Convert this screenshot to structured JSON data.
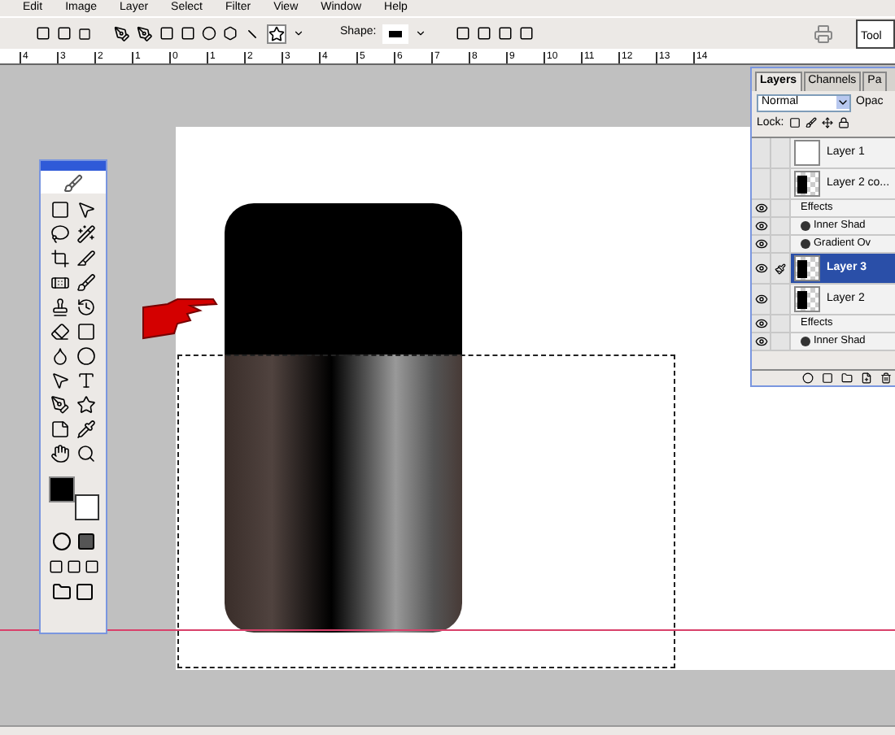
{
  "menu": [
    "Edit",
    "Image",
    "Layer",
    "Select",
    "Filter",
    "View",
    "Window",
    "Help"
  ],
  "options_bar": {
    "shape_label": "Shape:",
    "tool_tab": "Tool"
  },
  "ruler": [
    "4",
    "3",
    "2",
    "1",
    "0",
    "1",
    "2",
    "3",
    "4",
    "5",
    "6",
    "7",
    "8",
    "9",
    "10",
    "11",
    "12",
    "13",
    "14"
  ],
  "layers_panel": {
    "tabs": [
      {
        "label": "Layers",
        "selected": true
      },
      {
        "label": "Channels",
        "selected": false
      },
      {
        "label": "Pa",
        "selected": false
      }
    ],
    "blend_mode": "Normal",
    "opacity_label": "Opac",
    "lock_label": "Lock:",
    "rows": [
      {
        "kind": "layer",
        "name": "Layer 1",
        "visible": false,
        "selected": false,
        "blank_thumbnail": true
      },
      {
        "kind": "layer",
        "name": "Layer 2 co...",
        "visible": false,
        "selected": false,
        "blank_thumbnail": false
      },
      {
        "kind": "effects",
        "name": "Effects",
        "visible": true,
        "selected": false
      },
      {
        "kind": "effect",
        "name": "Inner Shad",
        "visible": true,
        "selected": false
      },
      {
        "kind": "effect",
        "name": "Gradient Ov",
        "visible": true,
        "selected": false
      },
      {
        "kind": "layer",
        "name": "Layer 3",
        "visible": true,
        "selected": true,
        "blank_thumbnail": false
      },
      {
        "kind": "layer",
        "name": "Layer 2",
        "visible": true,
        "selected": false,
        "blank_thumbnail": false
      },
      {
        "kind": "effects",
        "name": "Effects",
        "visible": true,
        "selected": false
      },
      {
        "kind": "effect",
        "name": "Inner Shad",
        "visible": true,
        "selected": false
      }
    ]
  }
}
